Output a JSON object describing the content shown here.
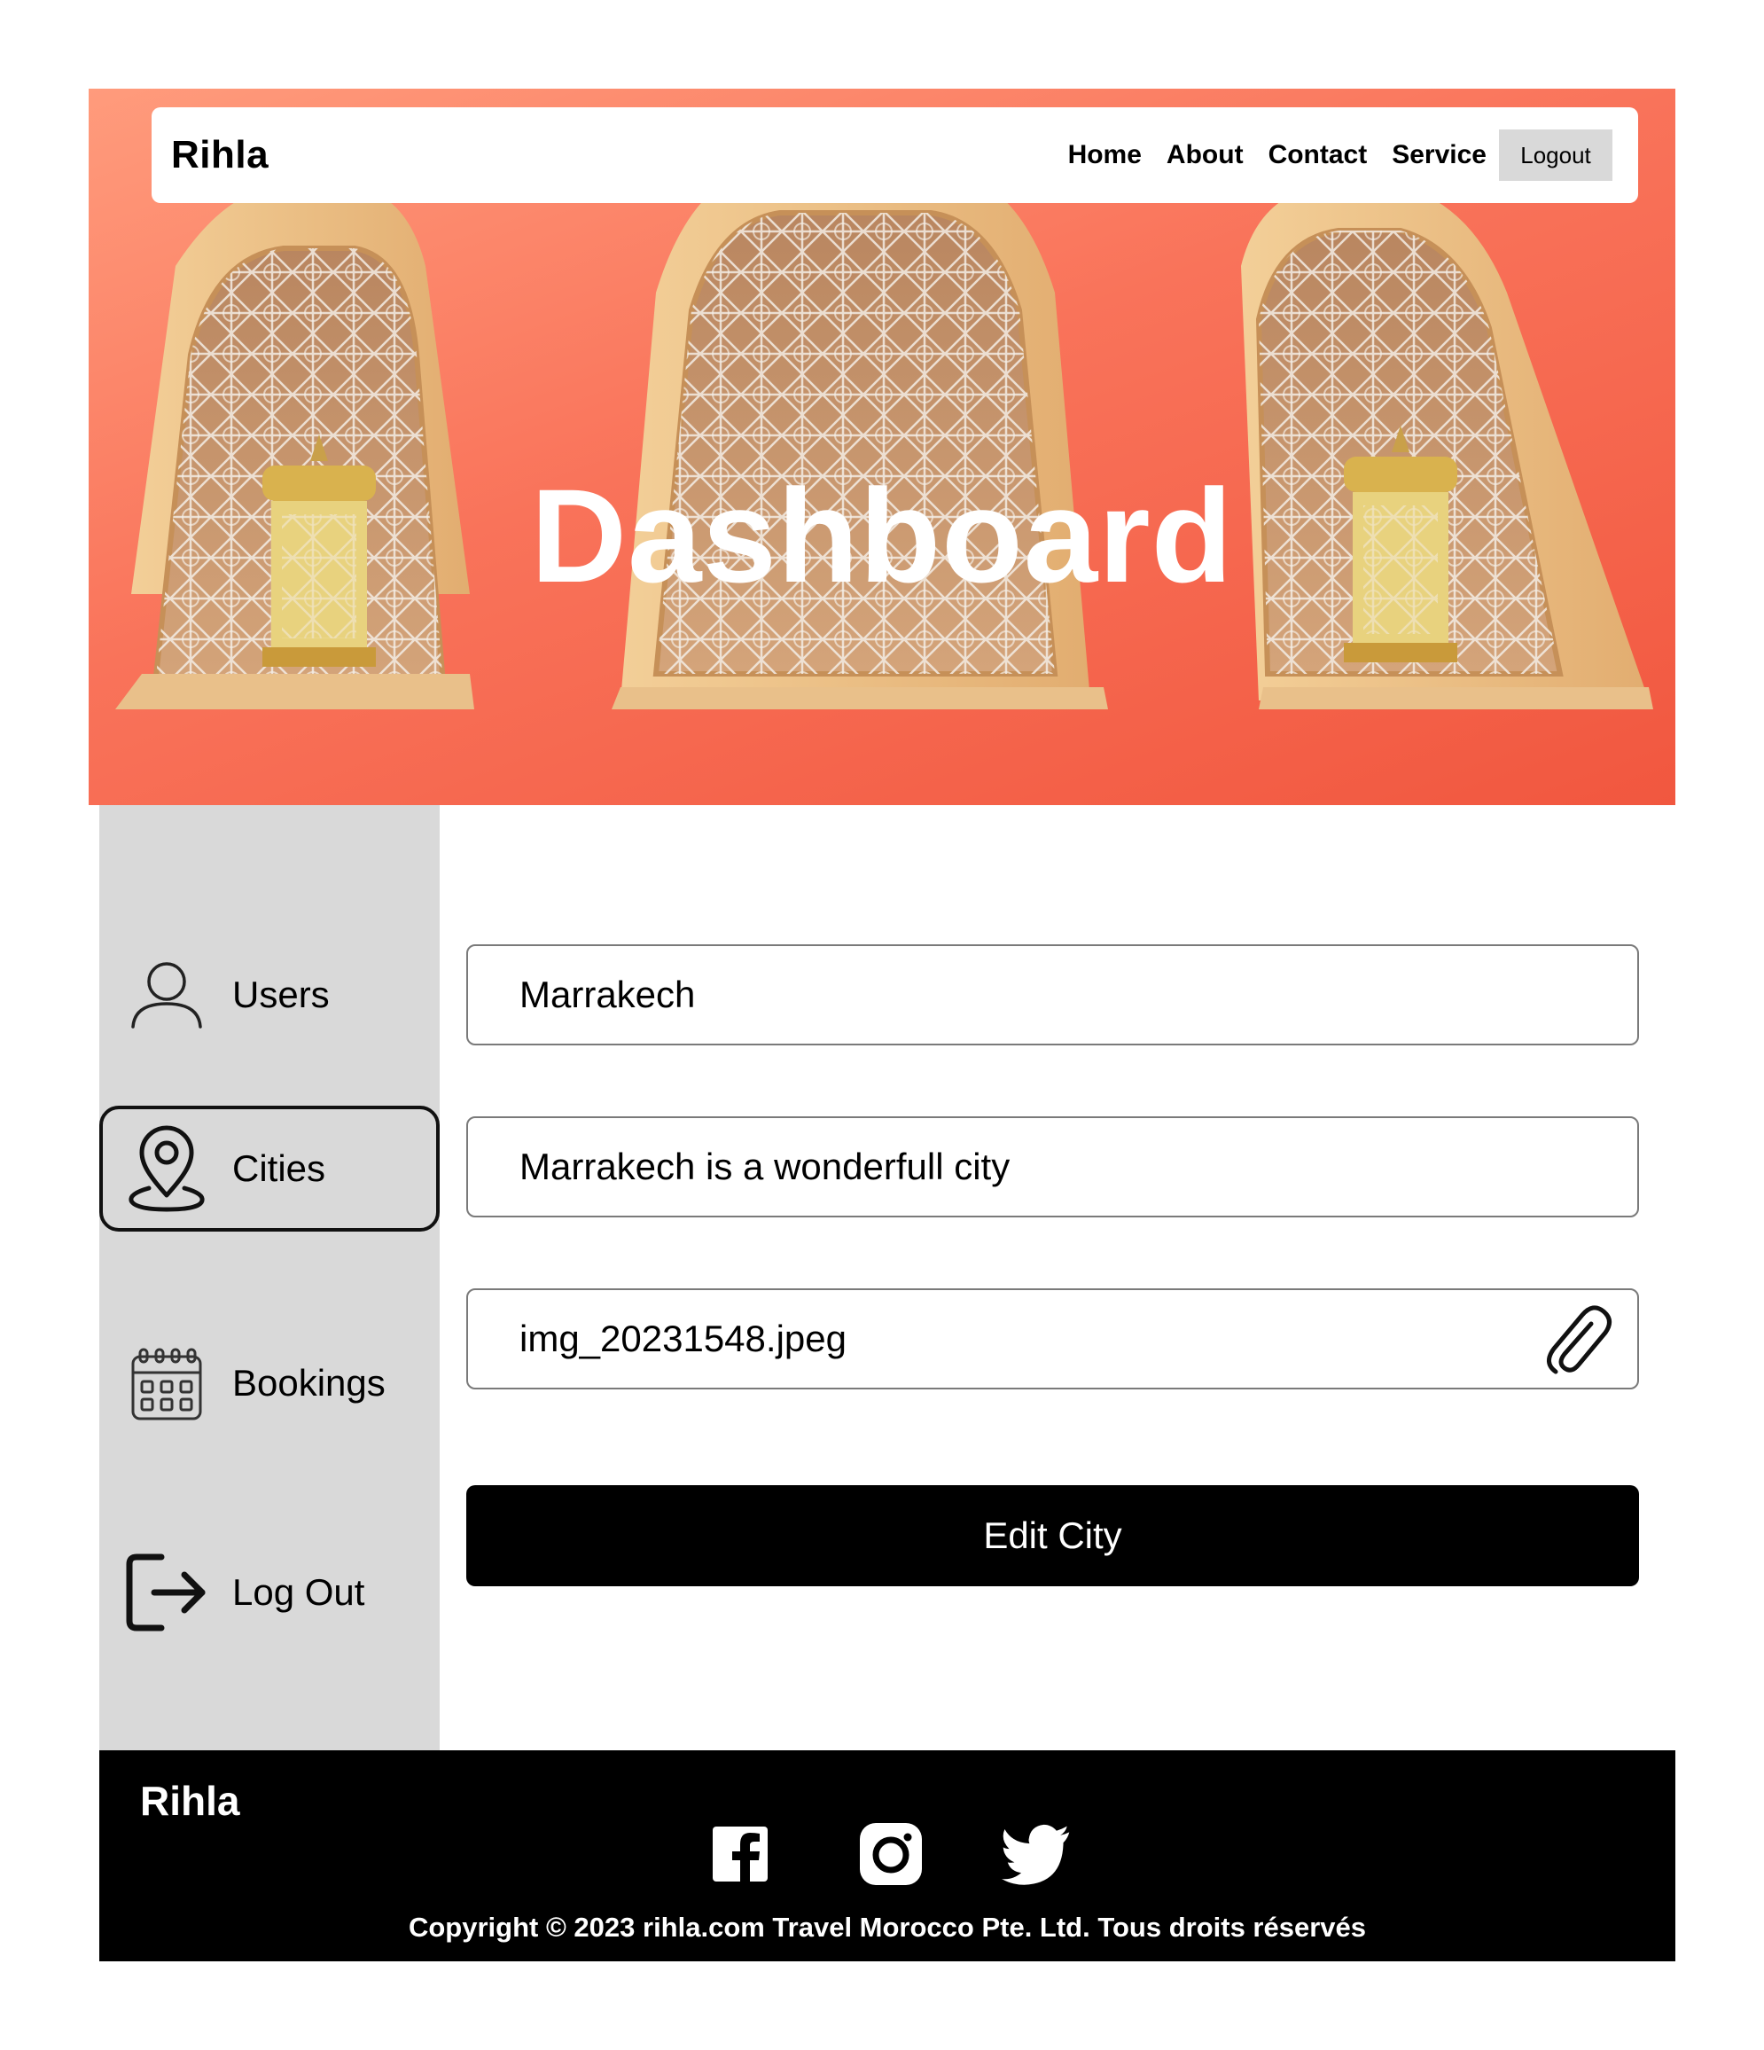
{
  "navbar": {
    "brand": "Rihla",
    "links": [
      "Home",
      "About",
      "Contact",
      "Service"
    ],
    "logout_label": "Logout"
  },
  "hero": {
    "title": "Dashboard",
    "background_colors": [
      "#ff9b7c",
      "#f1573f"
    ]
  },
  "sidebar": {
    "items": [
      {
        "label": "Users",
        "icon": "user-icon",
        "active": false
      },
      {
        "label": "Cities",
        "icon": "map-pin-icon",
        "active": true
      },
      {
        "label": "Bookings",
        "icon": "calendar-icon",
        "active": false
      },
      {
        "label": "Log Out",
        "icon": "logout-icon",
        "active": false
      }
    ]
  },
  "form": {
    "city_name_value": "Marrakech",
    "description_value": "Marrakech is a wonderfull city",
    "image_value": "img_20231548.jpeg",
    "attach_icon": "paperclip-icon",
    "submit_label": "Edit City"
  },
  "footer": {
    "brand": "Rihla",
    "social": [
      "facebook-icon",
      "instagram-icon",
      "twitter-icon"
    ],
    "copyright": "Copyright © 2023 rihla.com Travel Morocco Pte. Ltd. Tous droits réservés"
  }
}
